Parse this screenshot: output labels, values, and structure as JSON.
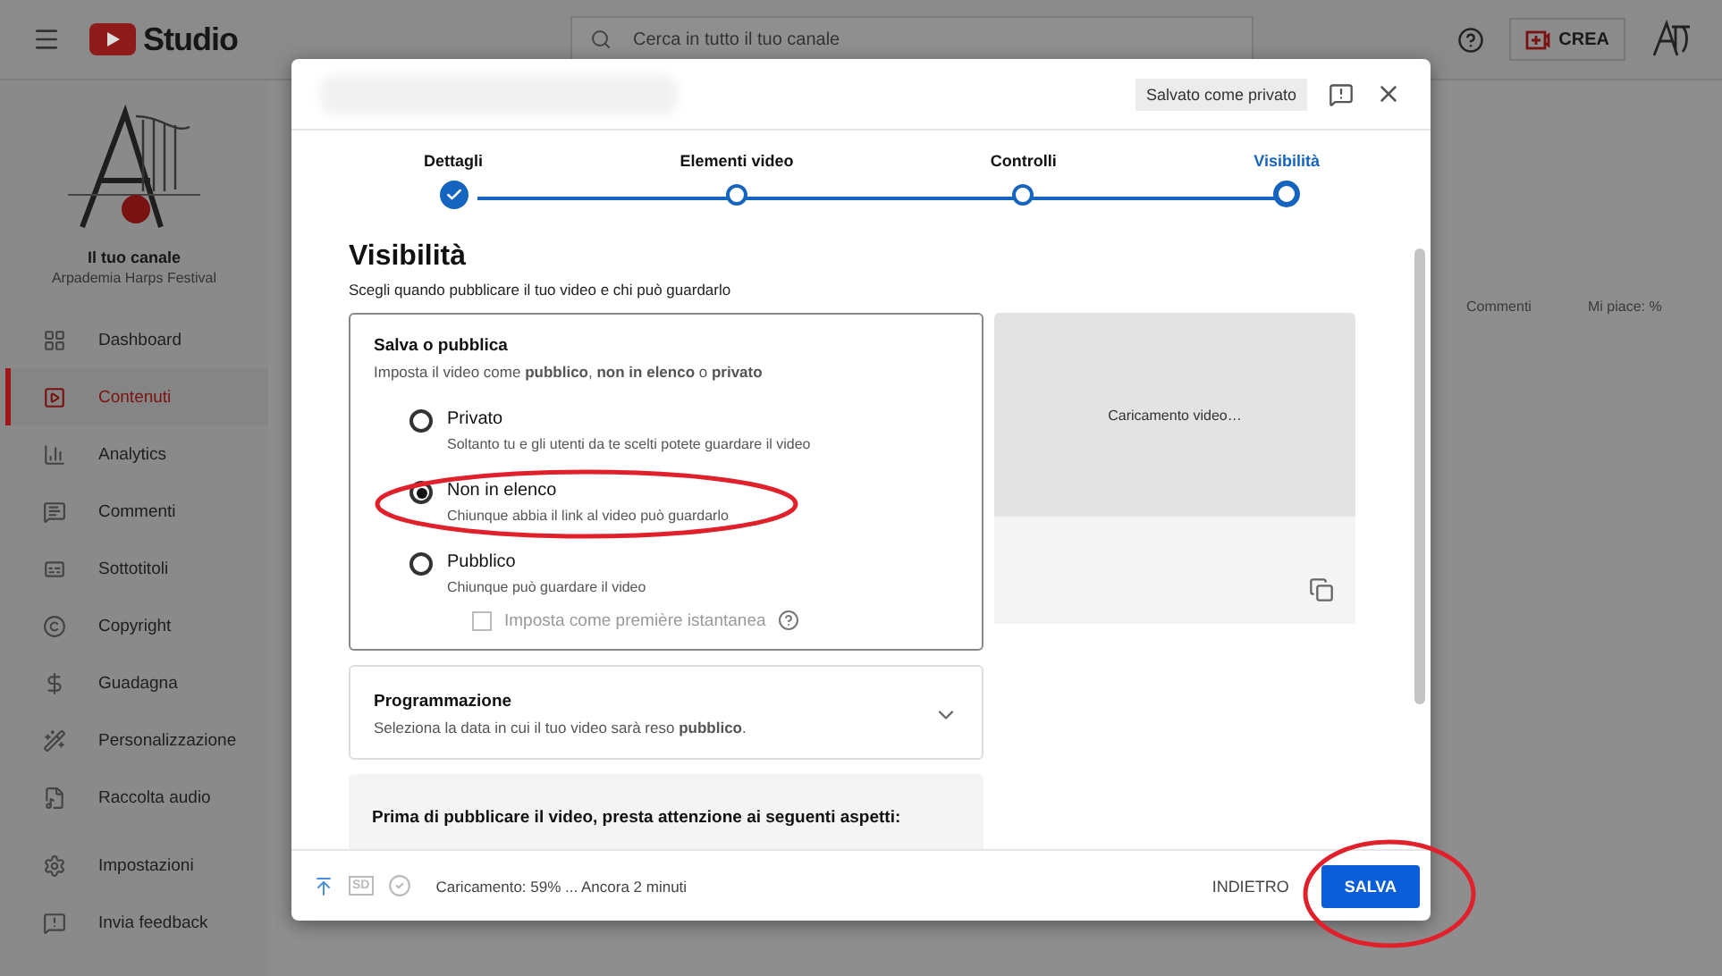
{
  "header": {
    "logo": "Studio",
    "search": {
      "placeholder": "Cerca in tutto il tuo canale"
    },
    "create": "CREA"
  },
  "channel": {
    "title": "Il tuo canale",
    "name": "Arpademia Harps Festival"
  },
  "sidebar": {
    "items": [
      {
        "label": "Dashboard",
        "selected": false
      },
      {
        "label": "Contenuti",
        "selected": true
      },
      {
        "label": "Analytics",
        "selected": false
      },
      {
        "label": "Commenti",
        "selected": false
      },
      {
        "label": "Sottotitoli",
        "selected": false
      },
      {
        "label": "Copyright",
        "selected": false
      },
      {
        "label": "Guadagna",
        "selected": false
      },
      {
        "label": "Personalizzazione",
        "selected": false
      },
      {
        "label": "Raccolta audio",
        "selected": false
      },
      {
        "label": "Impostazioni",
        "selected": false
      },
      {
        "label": "Invia feedback",
        "selected": false
      }
    ]
  },
  "table": {
    "columns": [
      "Commenti",
      "Mi piace: %"
    ]
  },
  "dialog": {
    "saved_status": "Salvato come privato",
    "steps": [
      {
        "label": "Dettagli",
        "done": true,
        "selected": false
      },
      {
        "label": "Elementi video",
        "done": false,
        "selected": false
      },
      {
        "label": "Controlli",
        "done": false,
        "selected": false
      },
      {
        "label": "Visibilità",
        "done": false,
        "selected": true
      }
    ],
    "title": "Visibilità",
    "subtitle": "Scegli quando pubblicare il tuo video e chi può guardarlo",
    "save_card": {
      "title": "Salva o pubblica",
      "description": "Imposta il video come **pubblico**, **non in elenco** o **privato**",
      "options": [
        {
          "label": "Privato",
          "description": "Soltanto tu e gli utenti da te scelti potete guardare il video",
          "selected": false
        },
        {
          "label": "Non in elenco",
          "description": "Chiunque abbia il link al video può guardarlo",
          "selected": true
        },
        {
          "label": "Pubblico",
          "description": "Chiunque può guardare il video",
          "selected": false
        }
      ],
      "premiere": {
        "label": "Imposta come première istantanea",
        "checked": false,
        "disabled": true
      }
    },
    "schedule": {
      "title": "Programmazione",
      "description": "Seleziona la data in cui il tuo video sarà reso **pubblico**.",
      "expanded": false
    },
    "notice": {
      "title": "Prima di pubblicare il video, presta attenzione ai seguenti aspetti:"
    },
    "preview": {
      "status": "Caricamento video…"
    },
    "footer": {
      "quality": "SD",
      "upload_status": "Caricamento: 59% ... Ancora 2 minuti",
      "back": "INDIETRO",
      "save": "SALVA"
    }
  }
}
